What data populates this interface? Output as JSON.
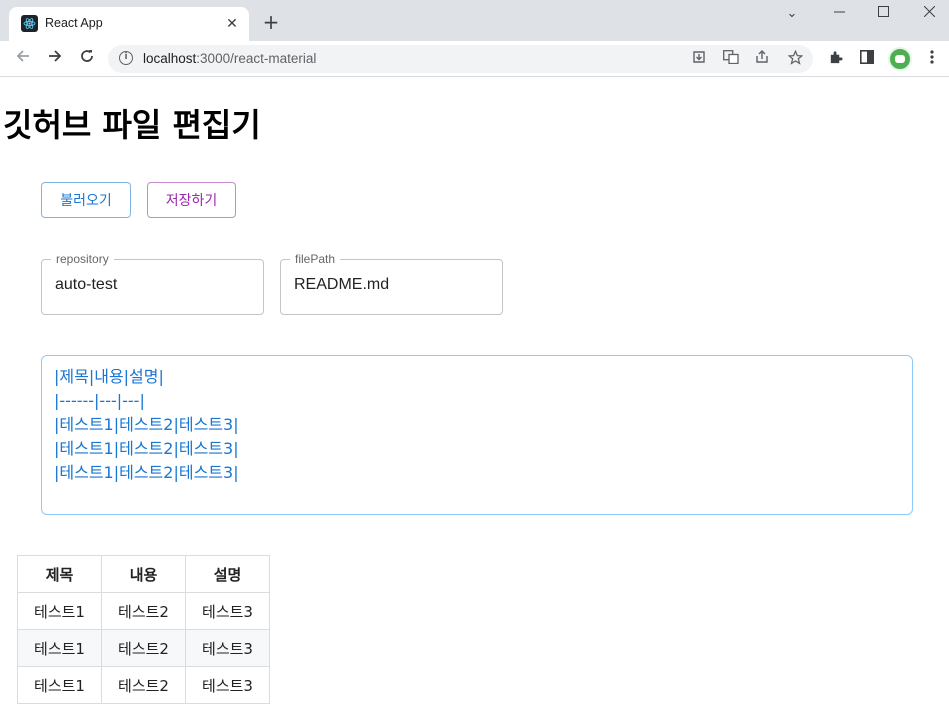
{
  "browser": {
    "tab_title": "React App",
    "tab_close_glyph": "✕",
    "new_tab_glyph": "+",
    "url_host": "localhost",
    "url_path": ":3000/react-material",
    "window_controls": {
      "minimize": "⌄",
      "maximize": "☐",
      "close": "✕"
    },
    "icons": [
      "back-icon",
      "forward-icon",
      "reload-icon",
      "site-info-icon",
      "install-icon",
      "translate-icon",
      "share-icon",
      "bookmark-star-icon",
      "extensions-icon",
      "side-panel-icon",
      "profile-avatar",
      "menu-icon"
    ]
  },
  "page": {
    "title": "깃허브 파일 편집기",
    "load_button": "불러오기",
    "save_button": "저장하기",
    "repository": {
      "label": "repository",
      "value": "auto-test"
    },
    "filePath": {
      "label": "filePath",
      "value": "README.md"
    },
    "editor_lines": [
      "|제목|내용|설명|",
      "|------|---|---|",
      "|테스트1|테스트2|테스트3|",
      "|테스트1|테스트2|테스트3|",
      "|테스트1|테스트2|테스트3|"
    ],
    "table": {
      "headers": [
        "제목",
        "내용",
        "설명"
      ],
      "rows": [
        [
          "테스트1",
          "테스트2",
          "테스트3"
        ],
        [
          "테스트1",
          "테스트2",
          "테스트3"
        ],
        [
          "테스트1",
          "테스트2",
          "테스트3"
        ]
      ]
    }
  },
  "colors": {
    "primary": "#1976d2",
    "secondary": "#9c27b0",
    "editor_border": "#90caf9"
  }
}
